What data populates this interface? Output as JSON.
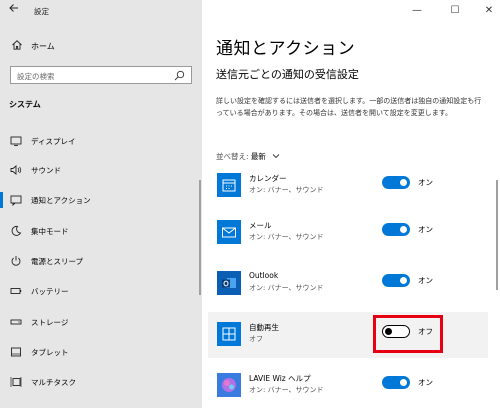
{
  "window": {
    "title": "設定",
    "controls": {
      "minimize": "—",
      "maximize": "☐",
      "close": "✕"
    }
  },
  "nav": {
    "home_label": "ホーム",
    "search_placeholder": "設定の検索",
    "section_label": "システム",
    "items": [
      {
        "label": "ディスプレイ",
        "icon": "display-icon"
      },
      {
        "label": "サウンド",
        "icon": "speaker-icon"
      },
      {
        "label": "通知とアクション",
        "icon": "notification-icon",
        "active": true
      },
      {
        "label": "集中モード",
        "icon": "moon-icon"
      },
      {
        "label": "電源とスリープ",
        "icon": "power-icon"
      },
      {
        "label": "バッテリー",
        "icon": "battery-icon"
      },
      {
        "label": "ストレージ",
        "icon": "storage-icon"
      },
      {
        "label": "タブレット",
        "icon": "tablet-icon"
      },
      {
        "label": "マルチタスク",
        "icon": "multitask-icon"
      }
    ]
  },
  "main": {
    "title": "通知とアクション",
    "section_title": "送信元ごとの通知の受信設定",
    "description": "詳しい設定を確認するには送信者を選択します。一部の送信者は独自の通知設定も行っている場合があります。その場合は、送信者を開いて設定を変更します。",
    "sort_label": "並べ替え:",
    "sort_value": "最新",
    "apps": [
      {
        "name": "カレンダー",
        "sub": "オン: バナー、サウンド",
        "state": "オン",
        "on": true,
        "icon": "calendar-icon"
      },
      {
        "name": "メール",
        "sub": "オン: バナー、サウンド",
        "state": "オン",
        "on": true,
        "icon": "mail-icon"
      },
      {
        "name": "Outlook",
        "sub": "オン: バナー、サウンド",
        "state": "オン",
        "on": true,
        "icon": "outlook-icon"
      },
      {
        "name": "自動再生",
        "sub": "オフ",
        "state": "オフ",
        "on": false,
        "icon": "autoplay-icon"
      },
      {
        "name": "LAVIE Wiz ヘルプ",
        "sub": "オン: バナー、サウンド",
        "state": "オン",
        "on": true,
        "icon": "help-app-icon"
      }
    ]
  },
  "colors": {
    "accent": "#0078d7",
    "nav_bg": "#e6e6e6",
    "highlight_box": "#e60012"
  }
}
